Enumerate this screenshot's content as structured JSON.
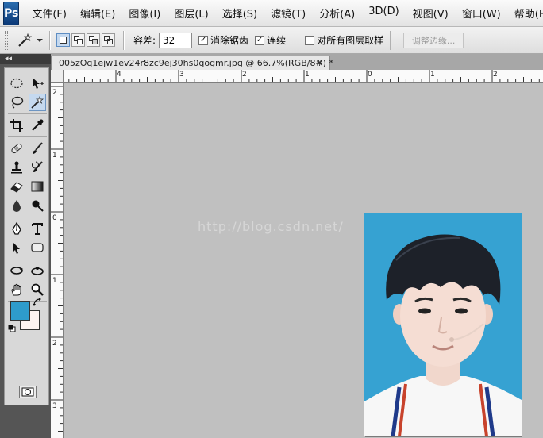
{
  "app": {
    "logo": "Ps"
  },
  "menu": [
    "文件(F)",
    "编辑(E)",
    "图像(I)",
    "图层(L)",
    "选择(S)",
    "滤镜(T)",
    "分析(A)",
    "3D(D)",
    "视图(V)",
    "窗口(W)",
    "帮助(H)"
  ],
  "options": {
    "tolerance_label": "容差:",
    "tolerance_value": "32",
    "anti_alias_label": "消除锯齿",
    "contiguous_label": "连续",
    "sample_all_label": "对所有图层取样",
    "refine_edge_label": "调整边缘...",
    "anti_alias_checked": true,
    "contiguous_checked": true,
    "sample_all_checked": false
  },
  "toolbox": {
    "collapse_label": "◂◂"
  },
  "document": {
    "tab_title": "005zOq1ejw1ev24r8zc9ej30hs0qogmr.jpg @ 66.7%(RGB/8#) *",
    "close_glyph": "✕"
  },
  "rulers": {
    "top_labels": [
      "4",
      "3",
      "2",
      "1",
      "0",
      "1",
      "2"
    ],
    "left_labels": [
      "2",
      "1",
      "0",
      "1",
      "2",
      "3"
    ]
  },
  "colors": {
    "foreground": "#2e9bcb",
    "background": "#fdf3f1",
    "photo_backdrop": "#36a2d2"
  },
  "canvas": {
    "watermark": "http://blog.csdn.net/"
  }
}
